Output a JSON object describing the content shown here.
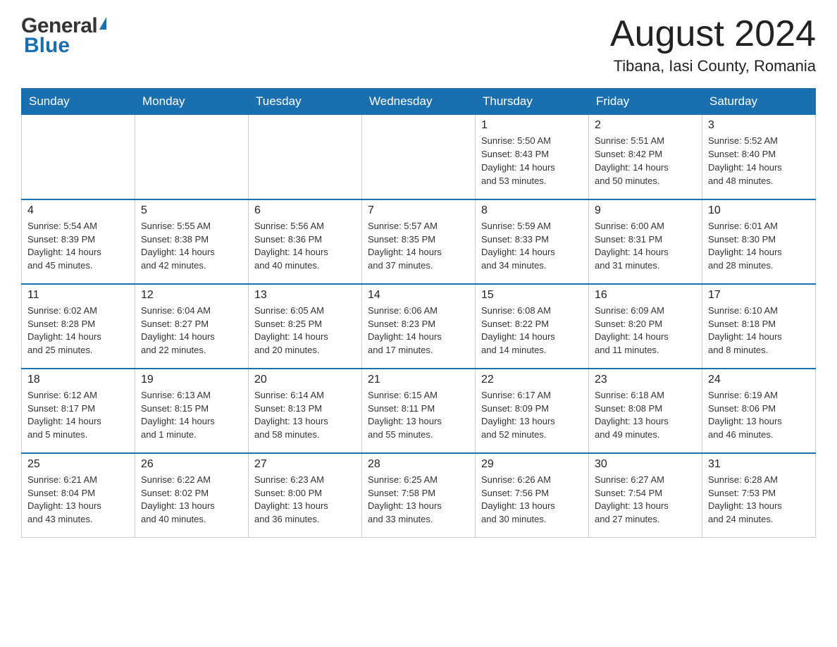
{
  "header": {
    "title": "August 2024",
    "subtitle": "Tibana, Iasi County, Romania",
    "logo_general": "General",
    "logo_blue": "Blue"
  },
  "days_of_week": [
    "Sunday",
    "Monday",
    "Tuesday",
    "Wednesday",
    "Thursday",
    "Friday",
    "Saturday"
  ],
  "weeks": [
    [
      {
        "day": "",
        "info": ""
      },
      {
        "day": "",
        "info": ""
      },
      {
        "day": "",
        "info": ""
      },
      {
        "day": "",
        "info": ""
      },
      {
        "day": "1",
        "info": "Sunrise: 5:50 AM\nSunset: 8:43 PM\nDaylight: 14 hours\nand 53 minutes."
      },
      {
        "day": "2",
        "info": "Sunrise: 5:51 AM\nSunset: 8:42 PM\nDaylight: 14 hours\nand 50 minutes."
      },
      {
        "day": "3",
        "info": "Sunrise: 5:52 AM\nSunset: 8:40 PM\nDaylight: 14 hours\nand 48 minutes."
      }
    ],
    [
      {
        "day": "4",
        "info": "Sunrise: 5:54 AM\nSunset: 8:39 PM\nDaylight: 14 hours\nand 45 minutes."
      },
      {
        "day": "5",
        "info": "Sunrise: 5:55 AM\nSunset: 8:38 PM\nDaylight: 14 hours\nand 42 minutes."
      },
      {
        "day": "6",
        "info": "Sunrise: 5:56 AM\nSunset: 8:36 PM\nDaylight: 14 hours\nand 40 minutes."
      },
      {
        "day": "7",
        "info": "Sunrise: 5:57 AM\nSunset: 8:35 PM\nDaylight: 14 hours\nand 37 minutes."
      },
      {
        "day": "8",
        "info": "Sunrise: 5:59 AM\nSunset: 8:33 PM\nDaylight: 14 hours\nand 34 minutes."
      },
      {
        "day": "9",
        "info": "Sunrise: 6:00 AM\nSunset: 8:31 PM\nDaylight: 14 hours\nand 31 minutes."
      },
      {
        "day": "10",
        "info": "Sunrise: 6:01 AM\nSunset: 8:30 PM\nDaylight: 14 hours\nand 28 minutes."
      }
    ],
    [
      {
        "day": "11",
        "info": "Sunrise: 6:02 AM\nSunset: 8:28 PM\nDaylight: 14 hours\nand 25 minutes."
      },
      {
        "day": "12",
        "info": "Sunrise: 6:04 AM\nSunset: 8:27 PM\nDaylight: 14 hours\nand 22 minutes."
      },
      {
        "day": "13",
        "info": "Sunrise: 6:05 AM\nSunset: 8:25 PM\nDaylight: 14 hours\nand 20 minutes."
      },
      {
        "day": "14",
        "info": "Sunrise: 6:06 AM\nSunset: 8:23 PM\nDaylight: 14 hours\nand 17 minutes."
      },
      {
        "day": "15",
        "info": "Sunrise: 6:08 AM\nSunset: 8:22 PM\nDaylight: 14 hours\nand 14 minutes."
      },
      {
        "day": "16",
        "info": "Sunrise: 6:09 AM\nSunset: 8:20 PM\nDaylight: 14 hours\nand 11 minutes."
      },
      {
        "day": "17",
        "info": "Sunrise: 6:10 AM\nSunset: 8:18 PM\nDaylight: 14 hours\nand 8 minutes."
      }
    ],
    [
      {
        "day": "18",
        "info": "Sunrise: 6:12 AM\nSunset: 8:17 PM\nDaylight: 14 hours\nand 5 minutes."
      },
      {
        "day": "19",
        "info": "Sunrise: 6:13 AM\nSunset: 8:15 PM\nDaylight: 14 hours\nand 1 minute."
      },
      {
        "day": "20",
        "info": "Sunrise: 6:14 AM\nSunset: 8:13 PM\nDaylight: 13 hours\nand 58 minutes."
      },
      {
        "day": "21",
        "info": "Sunrise: 6:15 AM\nSunset: 8:11 PM\nDaylight: 13 hours\nand 55 minutes."
      },
      {
        "day": "22",
        "info": "Sunrise: 6:17 AM\nSunset: 8:09 PM\nDaylight: 13 hours\nand 52 minutes."
      },
      {
        "day": "23",
        "info": "Sunrise: 6:18 AM\nSunset: 8:08 PM\nDaylight: 13 hours\nand 49 minutes."
      },
      {
        "day": "24",
        "info": "Sunrise: 6:19 AM\nSunset: 8:06 PM\nDaylight: 13 hours\nand 46 minutes."
      }
    ],
    [
      {
        "day": "25",
        "info": "Sunrise: 6:21 AM\nSunset: 8:04 PM\nDaylight: 13 hours\nand 43 minutes."
      },
      {
        "day": "26",
        "info": "Sunrise: 6:22 AM\nSunset: 8:02 PM\nDaylight: 13 hours\nand 40 minutes."
      },
      {
        "day": "27",
        "info": "Sunrise: 6:23 AM\nSunset: 8:00 PM\nDaylight: 13 hours\nand 36 minutes."
      },
      {
        "day": "28",
        "info": "Sunrise: 6:25 AM\nSunset: 7:58 PM\nDaylight: 13 hours\nand 33 minutes."
      },
      {
        "day": "29",
        "info": "Sunrise: 6:26 AM\nSunset: 7:56 PM\nDaylight: 13 hours\nand 30 minutes."
      },
      {
        "day": "30",
        "info": "Sunrise: 6:27 AM\nSunset: 7:54 PM\nDaylight: 13 hours\nand 27 minutes."
      },
      {
        "day": "31",
        "info": "Sunrise: 6:28 AM\nSunset: 7:53 PM\nDaylight: 13 hours\nand 24 minutes."
      }
    ]
  ]
}
